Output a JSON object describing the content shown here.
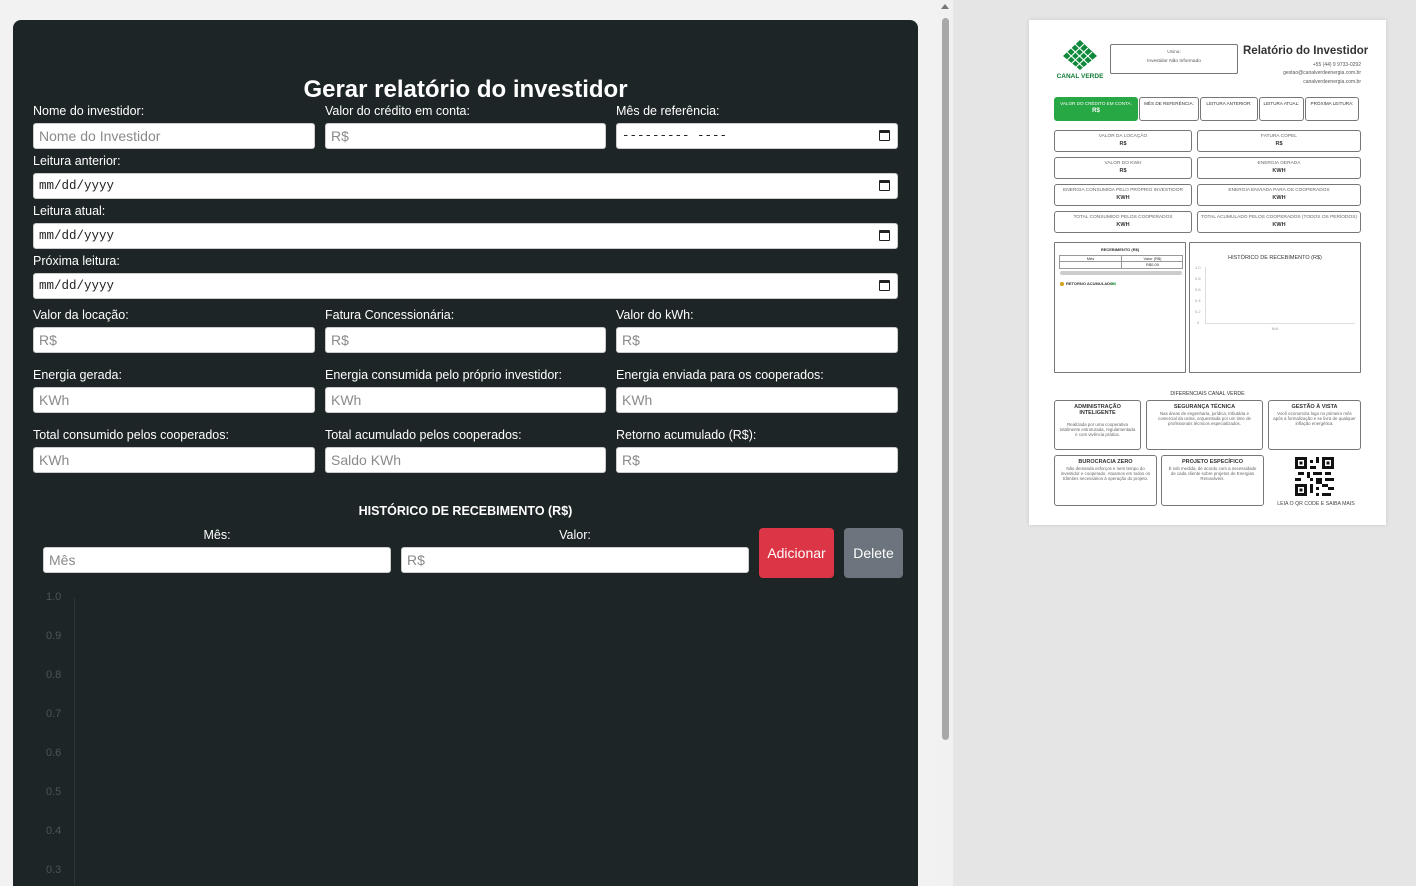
{
  "form": {
    "title": "Gerar relatório do investidor",
    "fields": {
      "investor_name": {
        "label": "Nome do investidor:",
        "placeholder": "Nome do Investidor"
      },
      "credit_value": {
        "label": "Valor do crédito em conta:",
        "placeholder": "R$"
      },
      "reference_month": {
        "label": "Mês de referência:",
        "value": "---------  ----"
      },
      "previous_reading": {
        "label": "Leitura anterior:",
        "value": "mm/dd/yyyy"
      },
      "current_reading": {
        "label": "Leitura atual:",
        "value": "mm/dd/yyyy"
      },
      "next_reading": {
        "label": "Próxima leitura:",
        "value": "mm/dd/yyyy"
      },
      "rental_value": {
        "label": "Valor da locação:",
        "placeholder": "R$"
      },
      "utility_bill": {
        "label": "Fatura Concessionária:",
        "placeholder": "R$"
      },
      "kwh_value": {
        "label": "Valor do kWh:",
        "placeholder": "R$"
      },
      "energy_generated": {
        "label": "Energia gerada:",
        "placeholder": "KWh"
      },
      "energy_self_consumed": {
        "label": "Energia consumida pelo próprio investidor:",
        "placeholder": "KWh"
      },
      "energy_sent": {
        "label": "Energia enviada para os cooperados:",
        "placeholder": "KWh"
      },
      "total_consumed": {
        "label": "Total consumido pelos cooperados:",
        "placeholder": "KWh"
      },
      "total_accumulated": {
        "label": "Total acumulado pelos cooperados:",
        "placeholder": "Saldo KWh"
      },
      "accumulated_return": {
        "label": "Retorno acumulado (R$):",
        "placeholder": "R$"
      }
    },
    "history": {
      "title": "HISTÓRICO DE RECEBIMENTO (R$)",
      "month_label": "Mês:",
      "month_placeholder": "Mês",
      "value_label": "Valor:",
      "value_placeholder": "R$",
      "add_button": "Adicionar",
      "delete_button": "Delete"
    }
  },
  "chart_data": {
    "type": "line",
    "title": "",
    "xlabel": "",
    "ylabel": "",
    "ylim": [
      0.3,
      1.0
    ],
    "y_ticks": [
      "1.0",
      "0.9",
      "0.8",
      "0.7",
      "0.6",
      "0.5",
      "0.4",
      "0.3"
    ],
    "categories": [],
    "values": []
  },
  "report": {
    "brand": "CANAL VERDE",
    "usina_label": "Usina:",
    "usina_value": "Investidor Não Informado",
    "title": "Relatório do Investidor",
    "phone": "+55 (44) 9 9733-0292",
    "email": "gestao@canalverdeenergia.com.br",
    "site": "canalverdeenergia.com.br",
    "tabs": [
      "VALOR DO CRÉDITO EM CONTA:",
      "MÊS DE REFERÊNCIA:",
      "LEITURA ANTERIOR:",
      "LEITURA ATUAL:",
      "PRÓXIMA LEITURA:"
    ],
    "credit_value": "R$",
    "cards": [
      {
        "label": "VALOR DA LOCAÇÃO",
        "value": "R$"
      },
      {
        "label": "FATURA COPEL",
        "value": "R$"
      },
      {
        "label": "VALOR DO KWH",
        "value": "R$"
      },
      {
        "label": "ENERGIA GERADA",
        "value": "KWH"
      },
      {
        "label": "ENERGIA CONSUMIDA PELO PRÓPRIO INVESTIDOR",
        "value": "KWH"
      },
      {
        "label": "ENERGIA ENVIADA PARA OS COOPERADOS",
        "value": "KWH"
      },
      {
        "label": "TOTAL CONSUMIDO PELOS COOPERADOS",
        "value": "KWH"
      },
      {
        "label": "TOTAL ACUMULADO PELOS COOPERADOS (TODOS OS PERÍODOS)",
        "value": "KWH"
      }
    ],
    "mini_table": {
      "title": "RECEBIMENTO (R$)",
      "col_month": "Mês",
      "col_value": "Valor (R$)",
      "row_value": "R$0,00",
      "return_label": "RETORNO ACUMULADO:",
      "return_value": "R$"
    },
    "mini_chart": {
      "title": "HISTÓRICO DE RECEBIMENTO (R$)",
      "y_ticks": [
        "1.0",
        "0.8",
        "0.6",
        "0.4",
        "0.2",
        "0"
      ],
      "x_label": "N/A"
    },
    "differentials_title": "DIFERENCIAIS CANAL VERDE",
    "features": [
      {
        "title": "ADMINISTRAÇÃO INTELIGENTE",
        "desc": "Realizada por uma cooperativa totalmente estruturada, regulamentada e com vivência prática."
      },
      {
        "title": "SEGURANÇA TÉCNICA",
        "desc": "Nas áreas de engenharia, jurídica, tributária e comercial da usina, orquestrada por um time de profissionais técnicos especializados."
      },
      {
        "title": "GESTÃO À VISTA",
        "desc": "Você economiza logo no primeiro mês após a formalização e se livra de qualquer inflação energética."
      },
      {
        "title": "BUROCRACIA ZERO",
        "desc": "Não demanda esforços e nem tempo do investidor e cooperado. Atuamos em todos os trâmites necessários à operação do projeto."
      },
      {
        "title": "PROJETO ESPECÍFICO",
        "desc": "É sob medida, de acordo com a necessidade de cada cliente sobre projetos de Energias Renováveis."
      }
    ],
    "qr_caption": "LEIA O QR CODE E SAIBA MAIS"
  }
}
